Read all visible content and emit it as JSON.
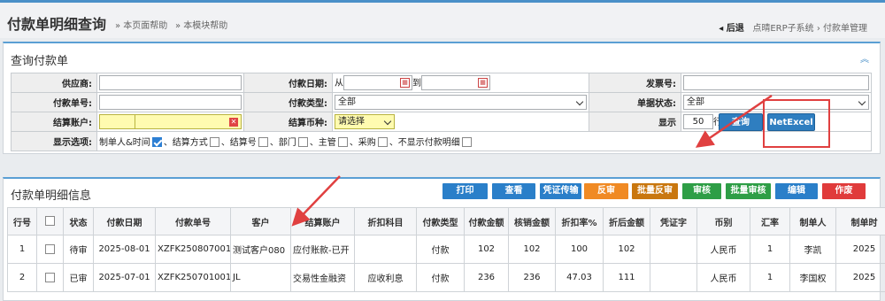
{
  "header": {
    "title": "付款单明细查询",
    "help_page": "» 本页面帮助",
    "help_module": "» 本模块帮助",
    "back": "◂ 后退",
    "crumb1": "点晴ERP子系统",
    "crumb_sep": "›",
    "crumb2": "付款单管理"
  },
  "query": {
    "title": "查询付款单",
    "collapse_icon": "︽",
    "labels": {
      "supplier": "供应商:",
      "pay_date": "付款日期:",
      "invoice_no": "发票号:",
      "pay_no": "付款单号:",
      "pay_type": "付款类型:",
      "doc_status": "单据状态:",
      "account": "结算账户:",
      "currency": "结算币种:",
      "display": "显示",
      "per_page": "行/页",
      "options": "显示选项:"
    },
    "date_from": "从",
    "date_to": "到",
    "pay_type_value": "全部",
    "doc_status_value": "全部",
    "currency_value": "请选择",
    "per_page_value": "50",
    "options": [
      {
        "label": "制单人&时间",
        "checked": true
      },
      {
        "label": "、结算方式",
        "checked": false
      },
      {
        "label": "、结算号",
        "checked": false
      },
      {
        "label": "、部门",
        "checked": false
      },
      {
        "label": "、主管",
        "checked": false
      },
      {
        "label": "、采购",
        "checked": false
      },
      {
        "label": "、不显示付款明细",
        "checked": false
      }
    ],
    "search_btn": "查询",
    "excel_btn": "NetExcel"
  },
  "detail": {
    "title": "付款单明细信息",
    "toolbar": [
      "打印",
      "查看",
      "凭证传输",
      "反审",
      "批量反审",
      "审核",
      "批量审核",
      "编辑",
      "作废"
    ],
    "columns": [
      "行号",
      "",
      "状态",
      "付款日期",
      "付款单号",
      "客户",
      "结算账户",
      "折扣科目",
      "付款类型",
      "付款金额",
      "核销金额",
      "折扣率%",
      "折后金额",
      "凭证字",
      "币别",
      "汇率",
      "制单人",
      "制单时"
    ],
    "rows": [
      [
        "1",
        "",
        "待审",
        "2025-08-01",
        "XZFK250807001",
        "测试客户080",
        "应付账款-已开",
        "",
        "付款",
        "102",
        "102",
        "100",
        "102",
        "",
        "人民币",
        "1",
        "李凯",
        "2025"
      ],
      [
        "2",
        "",
        "已审",
        "2025-07-01",
        "XZFK250701001",
        "JL",
        "交易性金融资",
        "应收利息",
        "付款",
        "236",
        "236",
        "47.03",
        "111",
        "",
        "人民币",
        "1",
        "李国权",
        "2025"
      ]
    ]
  },
  "colors": {
    "accent": "#4a90c8",
    "search_btn": "#2f7ec0",
    "excel_btn": "#2f7ec0",
    "highlight": "#e04040"
  }
}
